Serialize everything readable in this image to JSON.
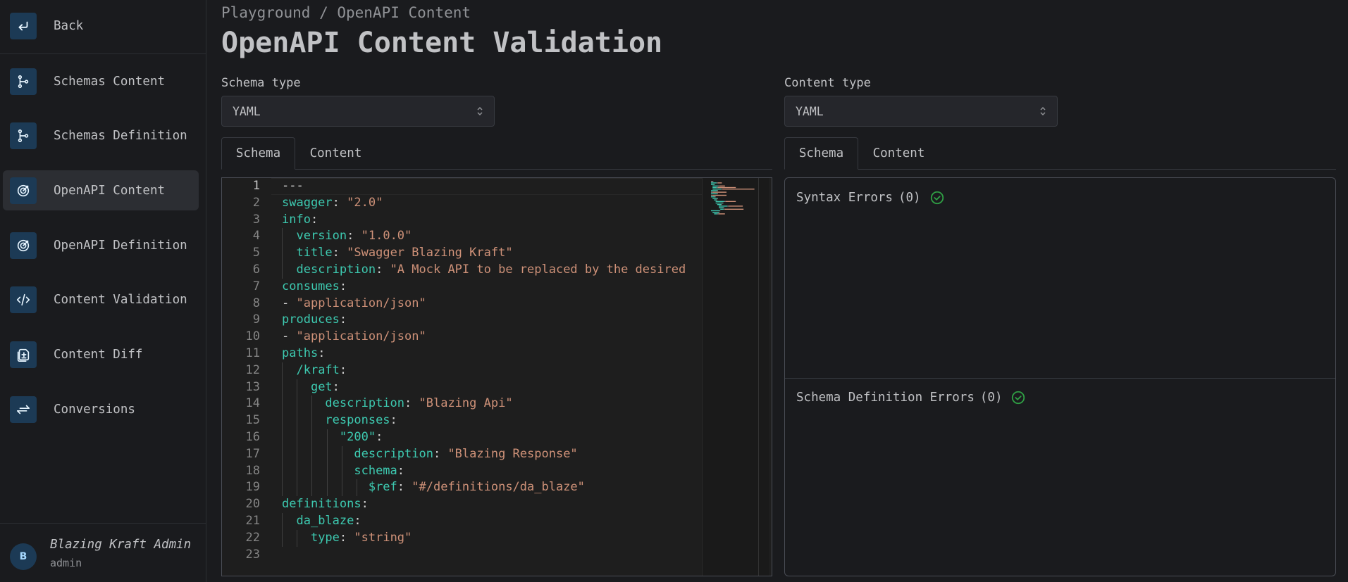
{
  "sidebar": {
    "back": "Back",
    "items": [
      {
        "label": "Schemas Content",
        "icon": "schema-tree-icon"
      },
      {
        "label": "Schemas Definition",
        "icon": "schema-tree-icon"
      },
      {
        "label": "OpenAPI Content",
        "icon": "target-icon"
      },
      {
        "label": "OpenAPI Definition",
        "icon": "target-icon"
      },
      {
        "label": "Content Validation",
        "icon": "code-icon"
      },
      {
        "label": "Content Diff",
        "icon": "file-diff-icon"
      },
      {
        "label": "Conversions",
        "icon": "arrows-exchange-icon"
      }
    ],
    "active_index": 2,
    "user": {
      "initial": "B",
      "name": "Blazing Kraft Admin",
      "role": "admin"
    }
  },
  "header": {
    "breadcrumb": "Playground / OpenAPI Content",
    "title": "OpenAPI Content Validation"
  },
  "left": {
    "label": "Schema type",
    "select_value": "YAML",
    "tabs": [
      "Schema",
      "Content"
    ],
    "active_tab": "Schema"
  },
  "right": {
    "label": "Content type",
    "select_value": "YAML",
    "tabs": [
      "Schema",
      "Content"
    ],
    "active_tab": "Schema",
    "syntax_errors": {
      "label": "Syntax Errors",
      "count": "(0)"
    },
    "definition_errors": {
      "label": "Schema Definition Errors",
      "count": "(0)"
    }
  },
  "editor": {
    "current_line": 1,
    "lines": [
      [
        [
          "p",
          "---"
        ]
      ],
      [
        [
          "k",
          "swagger"
        ],
        [
          "p",
          ": "
        ],
        [
          "s",
          "\"2.0\""
        ]
      ],
      [
        [
          "k",
          "info"
        ],
        [
          "p",
          ":"
        ]
      ],
      [
        [
          "p",
          "  "
        ],
        [
          "k",
          "version"
        ],
        [
          "p",
          ": "
        ],
        [
          "s",
          "\"1.0.0\""
        ]
      ],
      [
        [
          "p",
          "  "
        ],
        [
          "k",
          "title"
        ],
        [
          "p",
          ": "
        ],
        [
          "s",
          "\"Swagger Blazing Kraft\""
        ]
      ],
      [
        [
          "p",
          "  "
        ],
        [
          "k",
          "description"
        ],
        [
          "p",
          ": "
        ],
        [
          "s",
          "\"A Mock API to be replaced by the desired"
        ]
      ],
      [
        [
          "k",
          "consumes"
        ],
        [
          "p",
          ":"
        ]
      ],
      [
        [
          "p",
          "- "
        ],
        [
          "s",
          "\"application/json\""
        ]
      ],
      [
        [
          "k",
          "produces"
        ],
        [
          "p",
          ":"
        ]
      ],
      [
        [
          "p",
          "- "
        ],
        [
          "s",
          "\"application/json\""
        ]
      ],
      [
        [
          "k",
          "paths"
        ],
        [
          "p",
          ":"
        ]
      ],
      [
        [
          "p",
          "  "
        ],
        [
          "k",
          "/kraft"
        ],
        [
          "p",
          ":"
        ]
      ],
      [
        [
          "p",
          "    "
        ],
        [
          "k",
          "get"
        ],
        [
          "p",
          ":"
        ]
      ],
      [
        [
          "p",
          "      "
        ],
        [
          "k",
          "description"
        ],
        [
          "p",
          ": "
        ],
        [
          "s",
          "\"Blazing Api\""
        ]
      ],
      [
        [
          "p",
          "      "
        ],
        [
          "k",
          "responses"
        ],
        [
          "p",
          ":"
        ]
      ],
      [
        [
          "p",
          "        "
        ],
        [
          "k",
          "\"200\""
        ],
        [
          "p",
          ":"
        ]
      ],
      [
        [
          "p",
          "          "
        ],
        [
          "k",
          "description"
        ],
        [
          "p",
          ": "
        ],
        [
          "s",
          "\"Blazing Response\""
        ]
      ],
      [
        [
          "p",
          "          "
        ],
        [
          "k",
          "schema"
        ],
        [
          "p",
          ":"
        ]
      ],
      [
        [
          "p",
          "            "
        ],
        [
          "k",
          "$ref"
        ],
        [
          "p",
          ": "
        ],
        [
          "s",
          "\"#/definitions/da_blaze\""
        ]
      ],
      [
        [
          "k",
          "definitions"
        ],
        [
          "p",
          ":"
        ]
      ],
      [
        [
          "p",
          "  "
        ],
        [
          "k",
          "da_blaze"
        ],
        [
          "p",
          ":"
        ]
      ],
      [
        [
          "p",
          "    "
        ],
        [
          "k",
          "type"
        ],
        [
          "p",
          ": "
        ],
        [
          "s",
          "\"string\""
        ]
      ],
      []
    ]
  },
  "colors": {
    "key": "#3dc9b0",
    "string": "#ce9178",
    "check": "#2f9e44",
    "icon_bg": "#1c3a55"
  }
}
